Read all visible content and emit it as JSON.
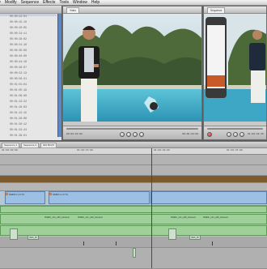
{
  "menu": [
    "fy",
    "Modify",
    "Sequence",
    "Effects",
    "Tools",
    "Window",
    "Help"
  ],
  "browser": {
    "items": [
      "00:00:12:01",
      "00:00:15:10",
      "00:00:20:05",
      "00:00:24:11",
      "00:00:28:02",
      "00:00:31:16",
      "00:00:35:09",
      "00:00:40:00",
      "00:00:44:18",
      "00:00:48:07",
      "00:00:52:13",
      "00:00:56:21",
      "00:01:01:04",
      "00:01:05:19",
      "00:01:09:08",
      "00:01:13:22",
      "00:01:18:03",
      "00:01:22:15",
      "00:01:26:06",
      "00:01:30:12",
      "00:01:34:24",
      "00:01:39:01"
    ]
  },
  "viewer": {
    "tab": "Video",
    "timecode_in": "00:00:43:08",
    "timecode_out": "00:00:18:00"
  },
  "canvas": {
    "tab": "Sequence",
    "timecode": "01:00:42:16"
  },
  "timeline": {
    "tabs": [
      "Sequence 1",
      "Sequence 2",
      "MIX BOAT"
    ],
    "ruler": [
      "01:00:00:00",
      "01:00:15:00",
      "01:00:30:00",
      "01:00:45:00"
    ],
    "video_clip_labels": [
      "GMKK1.1.0.T.0",
      "GMKK1.1.0.T.0"
    ],
    "audio_clip_labels": [
      "OSEK_mix_cdb_bsnoud",
      "OSEK_mix_cdb_bsnoud",
      "OSEK_mix_cdb_bsnoud",
      "OSEK_mix_cdb_bsnoud"
    ],
    "small_clips": [
      "BRS_05",
      "BRS_05"
    ]
  },
  "colors": {
    "video_clip": "#9bc0e4",
    "audio_clip": "#9fd09a",
    "marker": "#e0782c",
    "selection_bar": "#5c88c8"
  }
}
